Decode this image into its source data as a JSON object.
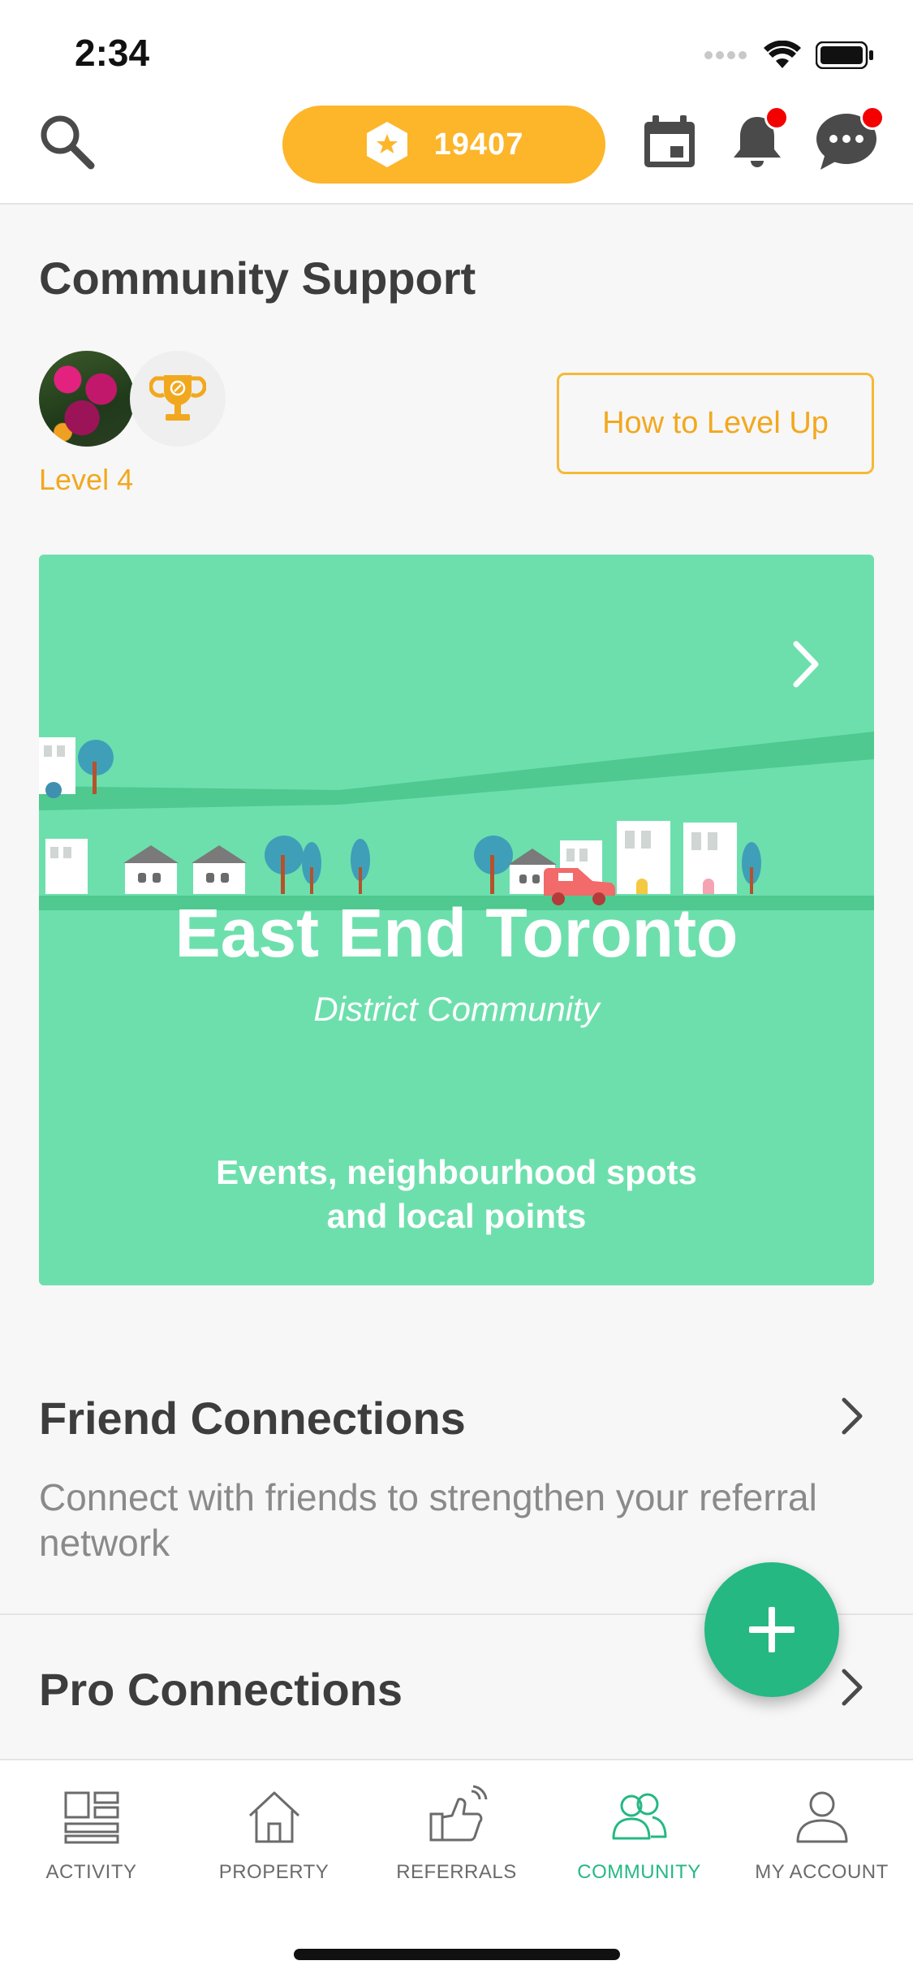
{
  "status_bar": {
    "time": "2:34",
    "icons": [
      "signal-icon",
      "wifi-icon",
      "battery-icon"
    ]
  },
  "header": {
    "points": "19407",
    "icons": [
      "search-icon",
      "star-hexagon-icon",
      "calendar-icon",
      "bell-icon",
      "chat-icon"
    ],
    "notification_badges": {
      "bell": true,
      "chat": true
    },
    "colors": {
      "points_pill": "#fdb52a",
      "badge": "#f40000"
    }
  },
  "community_support": {
    "title": "Community Support",
    "level_label": "Level 4",
    "level_up_button": "How to Level Up"
  },
  "district_card": {
    "title": "East End Toronto",
    "subtitle": "District Community",
    "description": "Events, neighbourhood spots and local points",
    "color": "#6ddfad"
  },
  "friend_connections": {
    "title": "Friend Connections",
    "description": "Connect with friends to strengthen your referral network"
  },
  "pro_connections": {
    "title": "Pro Connections"
  },
  "fab": {
    "icon": "plus-icon",
    "color": "#25b883"
  },
  "tabs": [
    {
      "label": "ACTIVITY",
      "icon": "activity-icon"
    },
    {
      "label": "PROPERTY",
      "icon": "house-icon"
    },
    {
      "label": "REFERRALS",
      "icon": "thumbs-up-icon"
    },
    {
      "label": "COMMUNITY",
      "icon": "people-icon",
      "active": true
    },
    {
      "label": "MY ACCOUNT",
      "icon": "person-icon"
    }
  ],
  "accent_color": "#25b883"
}
